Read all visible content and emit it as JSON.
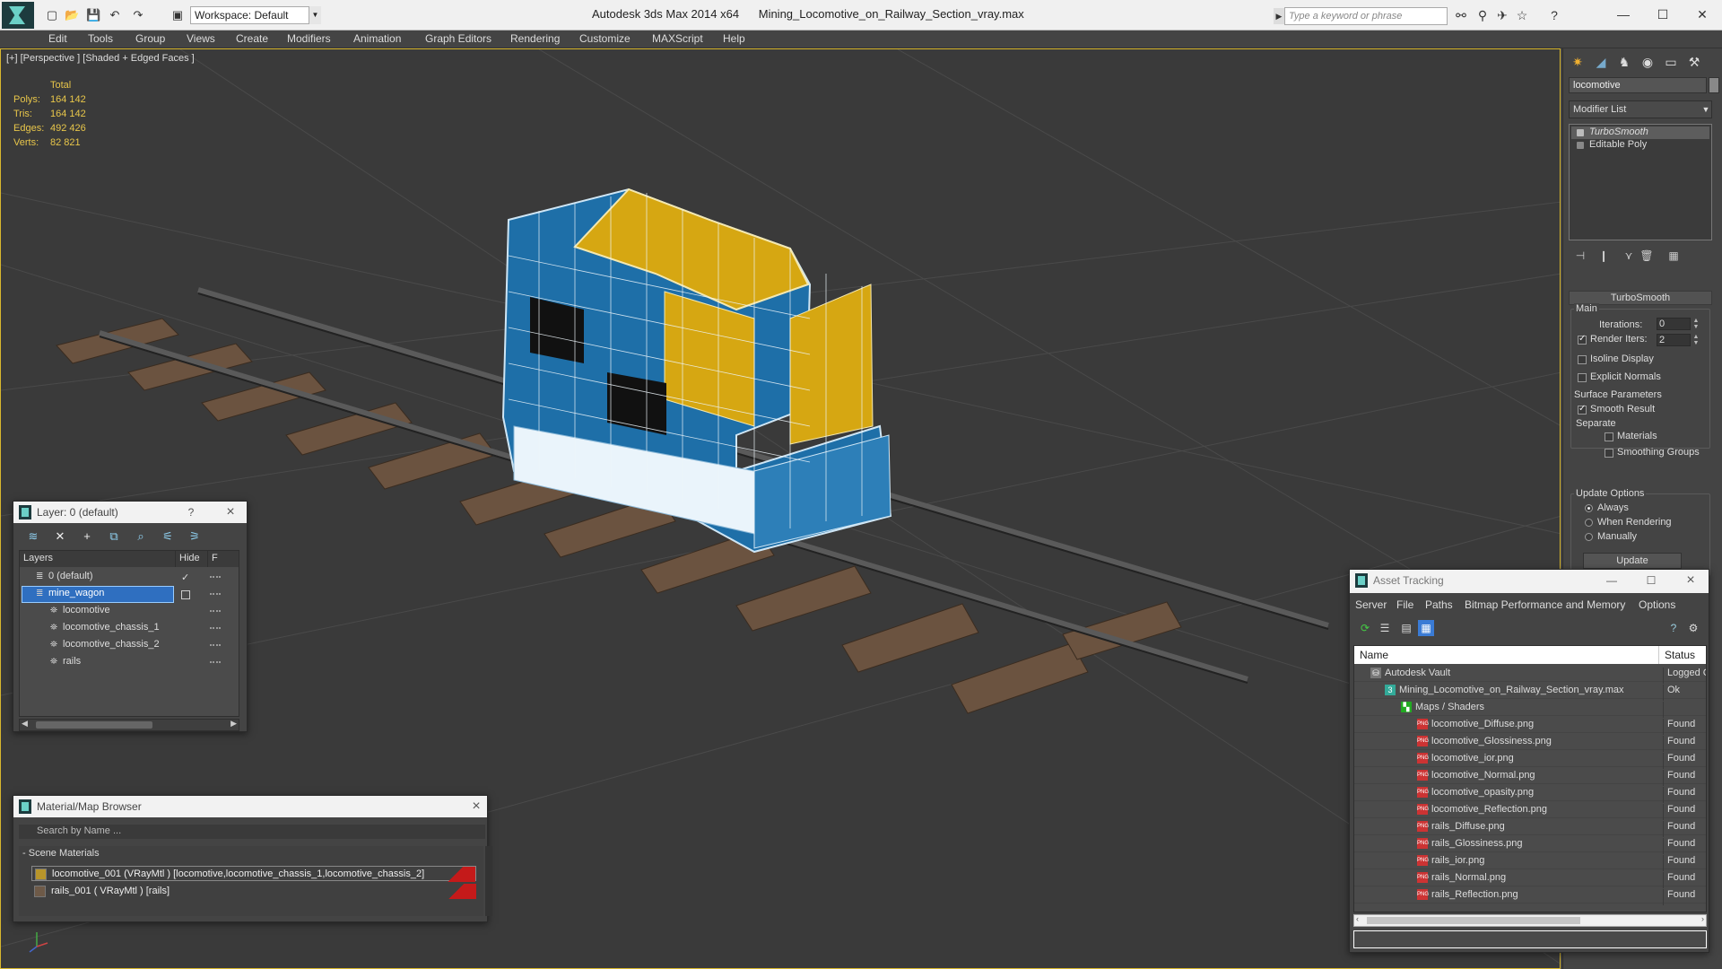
{
  "titlebar": {
    "app_title": "Autodesk 3ds Max  2014 x64",
    "file_name": "Mining_Locomotive_on_Railway_Section_vray.max",
    "workspace": "Workspace: Default",
    "search_placeholder": "Type a keyword or phrase"
  },
  "menu": [
    "Edit",
    "Tools",
    "Group",
    "Views",
    "Create",
    "Modifiers",
    "Animation",
    "Graph Editors",
    "Rendering",
    "Customize",
    "MAXScript",
    "Help"
  ],
  "viewport": {
    "label": "[+] [Perspective ] [Shaded + Edged Faces ]",
    "stats": {
      "header": "Total",
      "labels": [
        "Polys:",
        "Tris:",
        "Edges:",
        "Verts:"
      ],
      "values": [
        "164 142",
        "164 142",
        "492 426",
        "82 821"
      ]
    }
  },
  "command_panel": {
    "object_name": "locomotive",
    "modifier_list": "Modifier List",
    "stack": [
      "TurboSmooth",
      "Editable Poly"
    ],
    "rollout_title": "TurboSmooth",
    "main_label": "Main",
    "iterations_label": "Iterations:",
    "iterations_value": "0",
    "render_iters_label": "Render Iters:",
    "render_iters_value": "2",
    "isoline_label": "Isoline Display",
    "explicit_normals_label": "Explicit Normals",
    "surface_params_label": "Surface Parameters",
    "smooth_result_label": "Smooth Result",
    "separate_label": "Separate",
    "materials_label": "Materials",
    "smoothing_groups_label": "Smoothing Groups",
    "update_options_label": "Update Options",
    "always_label": "Always",
    "when_rendering_label": "When Rendering",
    "manually_label": "Manually",
    "update_button": "Update"
  },
  "layer_explorer": {
    "title": "Layer: 0 (default)",
    "help": "?",
    "col_layers": "Layers",
    "col_hide": "Hide",
    "col_f": "F",
    "rows": [
      {
        "name": "0 (default)",
        "level": 1
      },
      {
        "name": "mine_wagon",
        "level": 1
      },
      {
        "name": "locomotive",
        "level": 2
      },
      {
        "name": "locomotive_chassis_1",
        "level": 2
      },
      {
        "name": "locomotive_chassis_2",
        "level": 2
      },
      {
        "name": "rails",
        "level": 2
      }
    ]
  },
  "material_browser": {
    "title": "Material/Map Browser",
    "search_placeholder": "Search by Name ...",
    "group": "Scene Materials",
    "items": [
      "locomotive_001  (VRayMtl ) [locomotive,locomotive_chassis_1,locomotive_chassis_2]",
      "rails_001  ( VRayMtl ) [rails]"
    ]
  },
  "asset_tracking": {
    "title": "Asset Tracking",
    "menu": [
      "Server",
      "File",
      "Paths",
      "Bitmap Performance and Memory",
      "Options"
    ],
    "col_name": "Name",
    "col_status": "Status",
    "rows": [
      {
        "name": "Autodesk Vault",
        "status": "Logged C",
        "level": 1,
        "kind": "vault"
      },
      {
        "name": "Mining_Locomotive_on_Railway_Section_vray.max",
        "status": "Ok",
        "level": 2,
        "kind": "max"
      },
      {
        "name": "Maps / Shaders",
        "status": "",
        "level": 3,
        "kind": "folder"
      },
      {
        "name": "locomotive_Diffuse.png",
        "status": "Found",
        "level": 4,
        "kind": "png"
      },
      {
        "name": "locomotive_Glossiness.png",
        "status": "Found",
        "level": 4,
        "kind": "png"
      },
      {
        "name": "locomotive_ior.png",
        "status": "Found",
        "level": 4,
        "kind": "png"
      },
      {
        "name": "locomotive_Normal.png",
        "status": "Found",
        "level": 4,
        "kind": "png"
      },
      {
        "name": "locomotive_opasity.png",
        "status": "Found",
        "level": 4,
        "kind": "png"
      },
      {
        "name": "locomotive_Reflection.png",
        "status": "Found",
        "level": 4,
        "kind": "png"
      },
      {
        "name": "rails_Diffuse.png",
        "status": "Found",
        "level": 4,
        "kind": "png"
      },
      {
        "name": "rails_Glossiness.png",
        "status": "Found",
        "level": 4,
        "kind": "png"
      },
      {
        "name": "rails_ior.png",
        "status": "Found",
        "level": 4,
        "kind": "png"
      },
      {
        "name": "rails_Normal.png",
        "status": "Found",
        "level": 4,
        "kind": "png"
      },
      {
        "name": "rails_Reflection.png",
        "status": "Found",
        "level": 4,
        "kind": "png"
      }
    ]
  },
  "colors": {
    "viewport_bg": "#3a3a3a",
    "stats_text": "#e8c64a",
    "wire_blue": "#1e6fa8",
    "wire_yellow": "#d6a712",
    "selection": "#2f6fc0",
    "accent_teal": "#6bd0c7"
  }
}
